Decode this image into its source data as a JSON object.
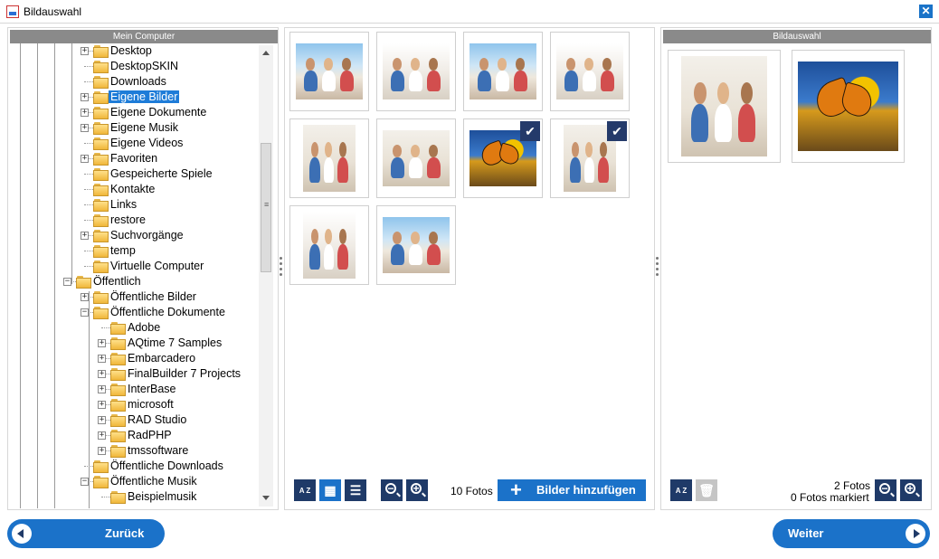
{
  "window": {
    "title": "Bildauswahl",
    "close_glyph": "✕"
  },
  "left_panel": {
    "header": "Mein Computer"
  },
  "tree": [
    {
      "label": "Desktop",
      "expander": "+",
      "depth": 1
    },
    {
      "label": "DesktopSKIN",
      "expander": "",
      "depth": 1
    },
    {
      "label": "Downloads",
      "expander": "",
      "depth": 1
    },
    {
      "label": "Eigene Bilder",
      "expander": "+",
      "depth": 1,
      "selected": true
    },
    {
      "label": "Eigene Dokumente",
      "expander": "+",
      "depth": 1
    },
    {
      "label": "Eigene Musik",
      "expander": "+",
      "depth": 1
    },
    {
      "label": "Eigene Videos",
      "expander": "",
      "depth": 1
    },
    {
      "label": "Favoriten",
      "expander": "+",
      "depth": 1
    },
    {
      "label": "Gespeicherte Spiele",
      "expander": "",
      "depth": 1
    },
    {
      "label": "Kontakte",
      "expander": "",
      "depth": 1
    },
    {
      "label": "Links",
      "expander": "",
      "depth": 1
    },
    {
      "label": "restore",
      "expander": "",
      "depth": 1
    },
    {
      "label": "Suchvorgänge",
      "expander": "+",
      "depth": 1
    },
    {
      "label": "temp",
      "expander": "",
      "depth": 1
    },
    {
      "label": "Virtuelle Computer",
      "expander": "",
      "depth": 1
    },
    {
      "label": "Öffentlich",
      "expander": "−",
      "depth": 0
    },
    {
      "label": "Öffentliche Bilder",
      "expander": "+",
      "depth": 1
    },
    {
      "label": "Öffentliche Dokumente",
      "expander": "−",
      "depth": 1
    },
    {
      "label": "Adobe",
      "expander": "",
      "depth": 2
    },
    {
      "label": "AQtime 7 Samples",
      "expander": "+",
      "depth": 2
    },
    {
      "label": "Embarcadero",
      "expander": "+",
      "depth": 2
    },
    {
      "label": "FinalBuilder 7 Projects",
      "expander": "+",
      "depth": 2
    },
    {
      "label": "InterBase",
      "expander": "+",
      "depth": 2
    },
    {
      "label": "microsoft",
      "expander": "+",
      "depth": 2
    },
    {
      "label": "RAD Studio",
      "expander": "+",
      "depth": 2
    },
    {
      "label": "RadPHP",
      "expander": "+",
      "depth": 2
    },
    {
      "label": "tmssoftware",
      "expander": "+",
      "depth": 2
    },
    {
      "label": "Öffentliche Downloads",
      "expander": "",
      "depth": 1
    },
    {
      "label": "Öffentliche Musik",
      "expander": "−",
      "depth": 1
    },
    {
      "label": "Beispielmusik",
      "expander": "",
      "depth": 2
    }
  ],
  "gallery": {
    "count_text": "10 Fotos",
    "add_button": "Bilder hinzufügen",
    "sort_label": "A Z",
    "check_glyph": "✔",
    "photos": [
      {
        "name": "photo-family-beach",
        "style": "sky",
        "orientation": "wide",
        "checked": false
      },
      {
        "name": "photo-family-sofa",
        "style": "bright",
        "orientation": "wide",
        "checked": false
      },
      {
        "name": "photo-family-porch",
        "style": "sky",
        "orientation": "wide",
        "checked": false
      },
      {
        "name": "photo-family-bed",
        "style": "bright",
        "orientation": "wide",
        "checked": false
      },
      {
        "name": "photo-family-floor",
        "style": "room",
        "orientation": "tall",
        "checked": false
      },
      {
        "name": "photo-family-couch",
        "style": "room",
        "orientation": "wide",
        "checked": false
      },
      {
        "name": "photo-butterfly",
        "style": "butterfly",
        "orientation": "wide",
        "checked": true
      },
      {
        "name": "photo-father-daughter",
        "style": "room",
        "orientation": "tall",
        "checked": true
      },
      {
        "name": "photo-mother-daughter",
        "style": "bright",
        "orientation": "tall",
        "checked": false
      },
      {
        "name": "photo-family-picnic",
        "style": "sky",
        "orientation": "wide",
        "checked": false
      }
    ]
  },
  "right_panel": {
    "header": "Bildauswahl",
    "count_text": "2 Fotos",
    "marked_text": "0 Fotos markiert",
    "sort_label": "A Z",
    "selected": [
      {
        "name": "selected-father-daughter",
        "style": "room",
        "orientation": "tall"
      },
      {
        "name": "selected-butterfly",
        "style": "butterfly",
        "orientation": "wide"
      }
    ]
  },
  "nav": {
    "back": "Zurück",
    "next": "Weiter"
  },
  "colors": {
    "accent": "#1b72c9",
    "dark_button": "#1f3a68",
    "selection": "#1e7cd8",
    "header_gray": "#8a8a8a"
  }
}
